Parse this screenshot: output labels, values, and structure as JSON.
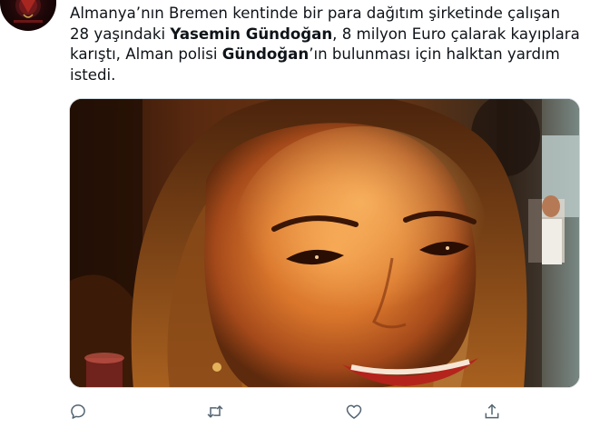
{
  "tweet": {
    "text_segments": [
      {
        "text": "Almanya’nın Bremen kentinde bir para dağıtım şirketinde çalışan 28 yaşındaki ",
        "bold": false
      },
      {
        "text": "Yasemin Gündoğan",
        "bold": true
      },
      {
        "text": ", 8 milyon Euro çalarak kayıplara karıştı, Alman polisi ",
        "bold": false
      },
      {
        "text": "Gündoğan",
        "bold": true
      },
      {
        "text": "’ın bulunması için halktan yardım istedi.",
        "bold": false
      }
    ]
  },
  "actions": {
    "reply_icon": "reply-icon",
    "retweet_icon": "retweet-icon",
    "like_icon": "heart-icon",
    "share_icon": "share-icon"
  },
  "colors": {
    "text": "#0f1419",
    "icon": "#536471",
    "border": "#cfd9de"
  }
}
